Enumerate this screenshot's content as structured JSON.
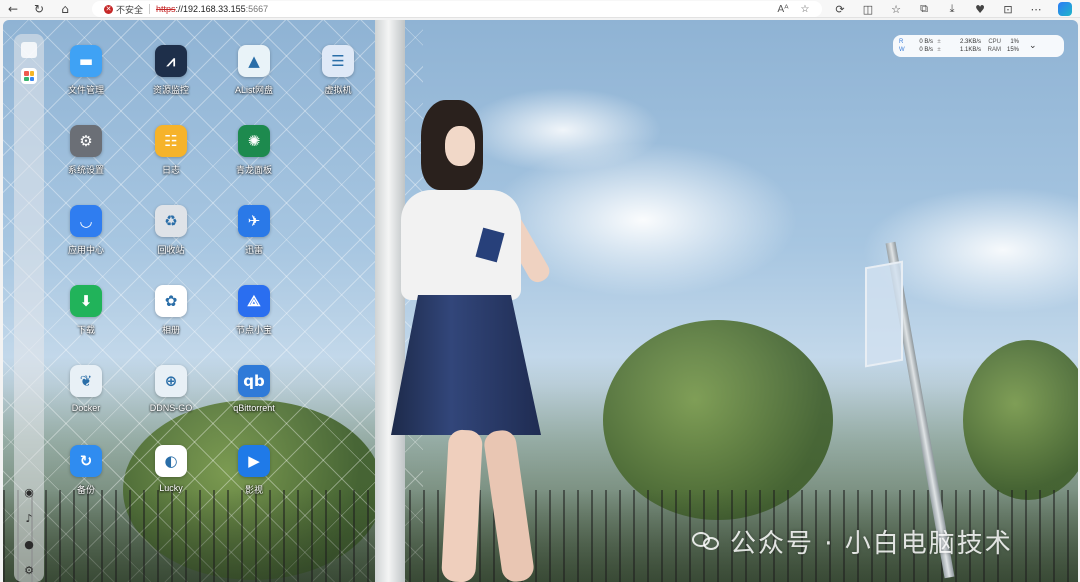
{
  "browser": {
    "back_icon": "back-arrow-icon",
    "refresh_icon": "refresh-icon",
    "home_icon": "home-icon",
    "security_label": "不安全",
    "url_protocol": "https",
    "url_sep": "://",
    "url_host": "192.168.33.155",
    "url_port": ":5667"
  },
  "monitor": {
    "r_label": "R",
    "w_label": "W",
    "r_speed": "0 B/s",
    "w_speed": "0 B/s",
    "r_arrow": "±",
    "w_arrow": "±",
    "r_speed2": "2.3KB/s",
    "w_speed2": "1.1KB/s",
    "cpu_label": "CPU",
    "ram_label": "RAM",
    "cpu_value": "1%",
    "ram_value": "15%"
  },
  "apps": [
    {
      "label": "文件管理",
      "icon": "folder-icon",
      "color": "#3fa2f5",
      "glyph": "▬"
    },
    {
      "label": "资源监控",
      "icon": "chart-icon",
      "color": "#1e2f4a",
      "glyph": "⩘"
    },
    {
      "label": "AList网盘",
      "icon": "alist-icon",
      "color": "#e9f3f8",
      "glyph": "▲"
    },
    {
      "label": "虚拟机",
      "icon": "server-icon",
      "color": "#dfe9f7",
      "glyph": "☰"
    },
    {
      "label": "系统设置",
      "icon": "gear-icon",
      "color": "#6b6f76",
      "glyph": "⚙"
    },
    {
      "label": "日志",
      "icon": "clipboard-icon",
      "color": "#f6b32a",
      "glyph": "☷"
    },
    {
      "label": "青龙面板",
      "icon": "qinglong-icon",
      "color": "#1d8a4e",
      "glyph": "✺"
    },
    {
      "label": "应用中心",
      "icon": "store-icon",
      "color": "#2f7df0",
      "glyph": "◡"
    },
    {
      "label": "回收站",
      "icon": "recycle-icon",
      "color": "#dfe3e8",
      "glyph": "♻"
    },
    {
      "label": "迅雷",
      "icon": "thunder-bird-icon",
      "color": "#2a79e8",
      "glyph": "✈"
    },
    {
      "label": "下载",
      "icon": "download-icon",
      "color": "#21b35a",
      "glyph": "⬇"
    },
    {
      "label": "相册",
      "icon": "photos-icon",
      "color": "#ffffff",
      "glyph": "✿"
    },
    {
      "label": "节点小宝",
      "icon": "node-icon",
      "color": "#2a6ef0",
      "glyph": "⟁"
    },
    {
      "label": "Docker",
      "icon": "docker-icon",
      "color": "#e8f0f6",
      "glyph": "❦"
    },
    {
      "label": "DDNS-GO",
      "icon": "ddns-globe-icon",
      "color": "#e8f0f6",
      "glyph": "⊕"
    },
    {
      "label": "qBittorrent",
      "icon": "qbittorrent-icon",
      "color": "#2f7ad8",
      "glyph": "qb"
    },
    {
      "label": "备份",
      "icon": "backup-icon",
      "color": "#2f8cf0",
      "glyph": "↻"
    },
    {
      "label": "Lucky",
      "icon": "lucky-icon",
      "color": "#ffffff",
      "glyph": "◐"
    },
    {
      "label": "影视",
      "icon": "video-icon",
      "color": "#1f7ae8",
      "glyph": "▶"
    }
  ],
  "watermark": {
    "text": "公众号 · 小白电脑技术"
  }
}
